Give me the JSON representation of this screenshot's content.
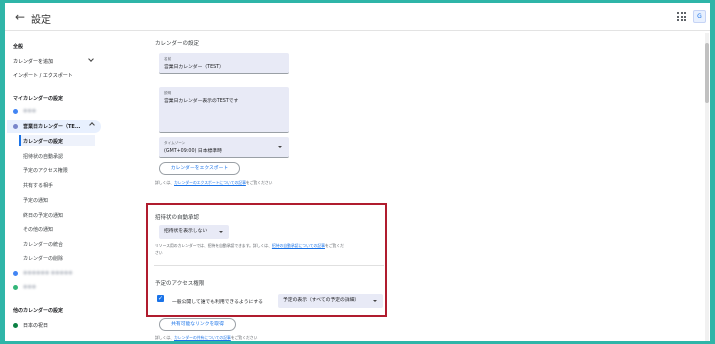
{
  "header": {
    "back_icon": "←",
    "title": "設定",
    "avatar_text": "G"
  },
  "sidebar": {
    "general": "全般",
    "add_calendar": "カレンダーを追加",
    "import_export": "インポート / エクスポート",
    "my_calendars_heading": "マイカレンダーの設定",
    "calendar1": "●●●",
    "calendar2": "営業日カレンダー（TE...",
    "sub_items": [
      "カレンダーの設定",
      "招待状の自動承認",
      "予定のアクセス権限",
      "共有する相手",
      "予定の通知",
      "終日の予定の通知",
      "その他の通知",
      "カレンダーの統合",
      "カレンダーの削除"
    ],
    "calendar3": "●●●●●● ●●●●●",
    "calendar4": "●●●",
    "other_calendars_heading": "他のカレンダーの設定",
    "holiday_calendar": "日本の祝日",
    "colors": {
      "cal1": "#4285f4",
      "cal2": "#7986cb",
      "cal3": "#4285f4",
      "cal4": "#33b679",
      "holiday": "#0b8043"
    }
  },
  "main": {
    "section_title": "カレンダーの設定",
    "name_label": "名前",
    "name_value": "営業日カレンダー（TEST）",
    "desc_label": "説明",
    "desc_value": "営業日カレンダー表示のTESTです",
    "tz_label": "タイムゾーン",
    "tz_value": "(GMT+09:00) 日本標準時",
    "export_button": "カレンダーをエクスポート",
    "export_note_prefix": "詳しくは、",
    "export_note_link": "カレンダーのエクスポートについての記事",
    "export_note_suffix": "をご覧ください",
    "auto_accept_title": "招待状の自動承認",
    "auto_accept_value": "招待状を表示しない",
    "auto_accept_note_prefix": "リソース用のカレンダーでは、招待を自動承認できます。詳しくは、",
    "auto_accept_note_link": "招待の自動承認についての記事",
    "auto_accept_note_suffix": "をご覧くだ",
    "auto_accept_note_line2": "さい",
    "access_title": "予定のアクセス権限",
    "public_checkbox_label": "一般公開して誰でも利用できるようにする",
    "public_access_value": "予定の表示（すべての予定の詳細）",
    "share_link_button": "共有可能なリンクを取得",
    "share_note_prefix": "詳しくは、",
    "share_note_link": "カレンダーの共有についての記事",
    "share_note_suffix": "をご覧ください"
  },
  "colors": {
    "accent": "#1a73e8",
    "highlight_border": "#b01c2e",
    "background": "#2fb5a8"
  }
}
